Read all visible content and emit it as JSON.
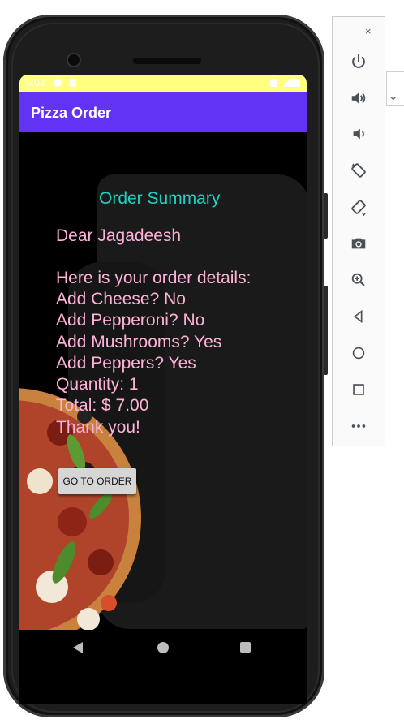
{
  "status_bar": {
    "time": "5:03"
  },
  "app": {
    "title": "Pizza Order"
  },
  "summary": {
    "heading": "Order Summary",
    "lines": [
      "Dear Jagadeesh",
      "",
      "Here is your order details:",
      "Add Cheese? No",
      "Add Pepperoni? No",
      "Add Mushrooms? Yes",
      "Add Peppers? Yes",
      "Quantity: 1",
      "Total: $ 7.00",
      "Thank you!"
    ]
  },
  "button": {
    "label": "GO TO ORDER"
  },
  "emulator_toolbar": {
    "minimize": "–",
    "close": "×",
    "icons": [
      "power-icon",
      "volume-up-icon",
      "volume-down-icon",
      "rotate-left-icon",
      "rotate-right-icon",
      "camera-icon",
      "zoom-icon",
      "back-icon",
      "home-icon",
      "overview-icon",
      "more-icon"
    ]
  },
  "colors": {
    "status_bar": "#ffff80",
    "app_bar": "#6232f5",
    "heading": "#1ed3c4",
    "body_text": "#ffb2d9"
  }
}
